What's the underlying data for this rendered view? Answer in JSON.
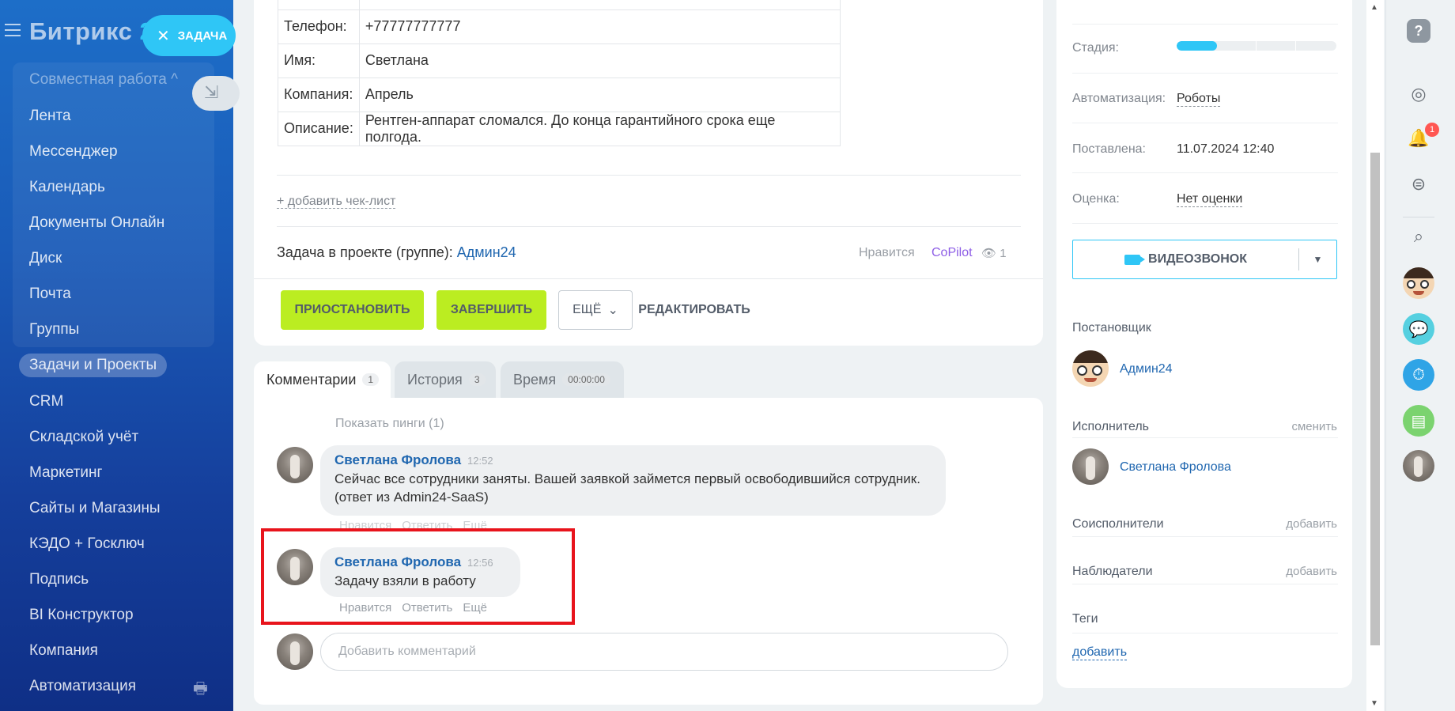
{
  "sidebar": {
    "brand_name": "Битрикс",
    "brand_num": "2",
    "task_pill": "ЗАДАЧА",
    "group_title": "Совместная работа ^",
    "group_items": [
      "Лента",
      "Мессенджер",
      "Календарь",
      "Документы Онлайн",
      "Диск",
      "Почта",
      "Группы"
    ],
    "items": [
      "Задачи и Проекты",
      "CRM",
      "Складской учёт",
      "Маркетинг",
      "Сайты и Магазины",
      "КЭДО + Госключ",
      "Подпись",
      "BI Конструктор",
      "Компания",
      "Автоматизация"
    ]
  },
  "task": {
    "fields": [
      {
        "label": "Телефон:",
        "value": "+77777777777"
      },
      {
        "label": "Имя:",
        "value": "Светлана"
      },
      {
        "label": "Компания:",
        "value": "Апрель"
      },
      {
        "label": "Описание:",
        "value": "Рентген-аппарат сломался. До конца гарантийного срока еще полгода."
      }
    ],
    "add_checklist": "+ добавить чек-лист",
    "project_prefix": "Задача в проекте (группе):",
    "project_name": "Админ24",
    "likes": "Нравится",
    "copilot": "CoPilot",
    "views": "👁 1"
  },
  "actions": {
    "pause": "ПРИОСТАНОВИТЬ",
    "complete": "ЗАВЕРШИТЬ",
    "more": "ЕЩЁ",
    "edit": "РЕДАКТИРОВАТЬ"
  },
  "tabs": [
    {
      "label": "Комментарии",
      "count": "1"
    },
    {
      "label": "История",
      "count": "3"
    },
    {
      "label": "Время",
      "count": "00:00:00"
    }
  ],
  "comments": {
    "show_pings": "Показать пинги (1)",
    "list": [
      {
        "author": "Светлана Фролова",
        "time": "12:52",
        "text": "Сейчас все сотрудники заняты. Вашей заявкой займется первый освободившийся сотрудник. (ответ из Admin24-SaaS)"
      },
      {
        "author": "Светлана Фролова",
        "time": "12:56",
        "text": "Задачу взяли в работу"
      }
    ],
    "action_like": "Нравится",
    "action_reply": "Ответить",
    "action_more": "Ещё",
    "input_placeholder": "Добавить комментарий"
  },
  "details": {
    "stage_label": "Стадия:",
    "stage_progress": 0.25,
    "automation_label": "Автоматизация:",
    "automation_value": "Роботы",
    "posted_label": "Поставлена:",
    "posted_value": "11.07.2024 12:40",
    "rating_label": "Оценка:",
    "rating_value": "Нет оценки",
    "video_call": "ВИДЕОЗВОНОК",
    "creator_title": "Постановщик",
    "creator_name": "Админ24",
    "assignee_title": "Исполнитель",
    "assignee_change": "сменить",
    "assignee_name": "Светлана Фролова",
    "coexec_title": "Соисполнители",
    "coexec_add": "добавить",
    "observers_title": "Наблюдатели",
    "observers_add": "добавить",
    "tags_title": "Теги",
    "tags_add": "добавить"
  },
  "iconbar": {
    "help": "?",
    "notification_count": "1"
  },
  "colors": {
    "accent": "#2fc6f6",
    "action_green": "#bbed21",
    "link": "#2067b0",
    "highlight_border": "#e8141c"
  }
}
